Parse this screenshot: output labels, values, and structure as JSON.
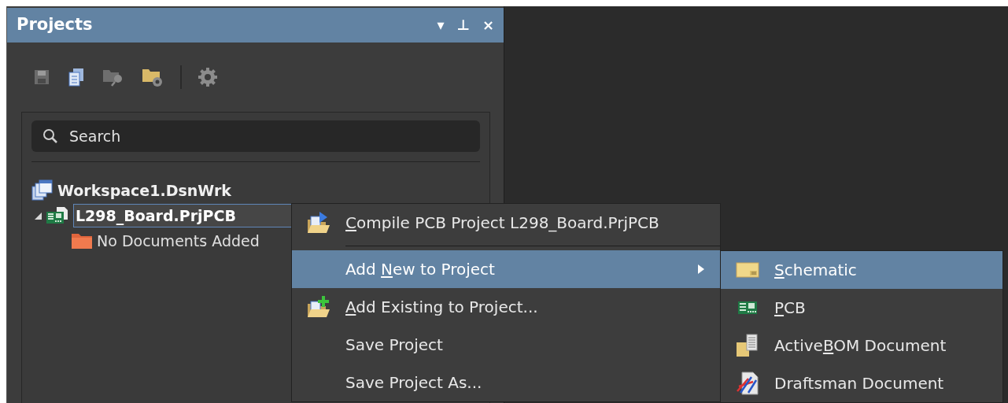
{
  "panel": {
    "title": "Projects",
    "controls": [
      "▾",
      "⊥",
      "×"
    ]
  },
  "search": {
    "placeholder": "Search"
  },
  "tree": [
    {
      "label": "Workspace1.DsnWrk",
      "kind": "workspace",
      "selected": false,
      "children": [
        {
          "label": "L298_Board.PrjPCB",
          "kind": "project",
          "selected": true,
          "expanded": true,
          "children": [
            {
              "label": "No Documents Added",
              "kind": "folder",
              "selected": false
            }
          ]
        }
      ]
    }
  ],
  "context_menu": [
    {
      "kind": "item",
      "key": "C",
      "post": "ompile PCB Project L298_Board.PrjPCB",
      "selected": false,
      "separator_after": true
    },
    {
      "kind": "submenu",
      "pre": "Add ",
      "key": "N",
      "post": "ew to Project",
      "selected": true
    },
    {
      "kind": "item",
      "key": "A",
      "post": "dd Existing to Project...",
      "selected": false
    },
    {
      "kind": "item",
      "pre": "Save Project",
      "selected": false
    },
    {
      "kind": "item",
      "pre": "Save Project As...",
      "selected": false
    }
  ],
  "submenu": [
    {
      "key": "S",
      "post": "chematic",
      "selected": true
    },
    {
      "key": "P",
      "post": "CB",
      "selected": false
    },
    {
      "pre": "Active",
      "key": "B",
      "post": "OM Document",
      "selected": false
    },
    {
      "pre": "Draftsman Document",
      "selected": false
    }
  ]
}
